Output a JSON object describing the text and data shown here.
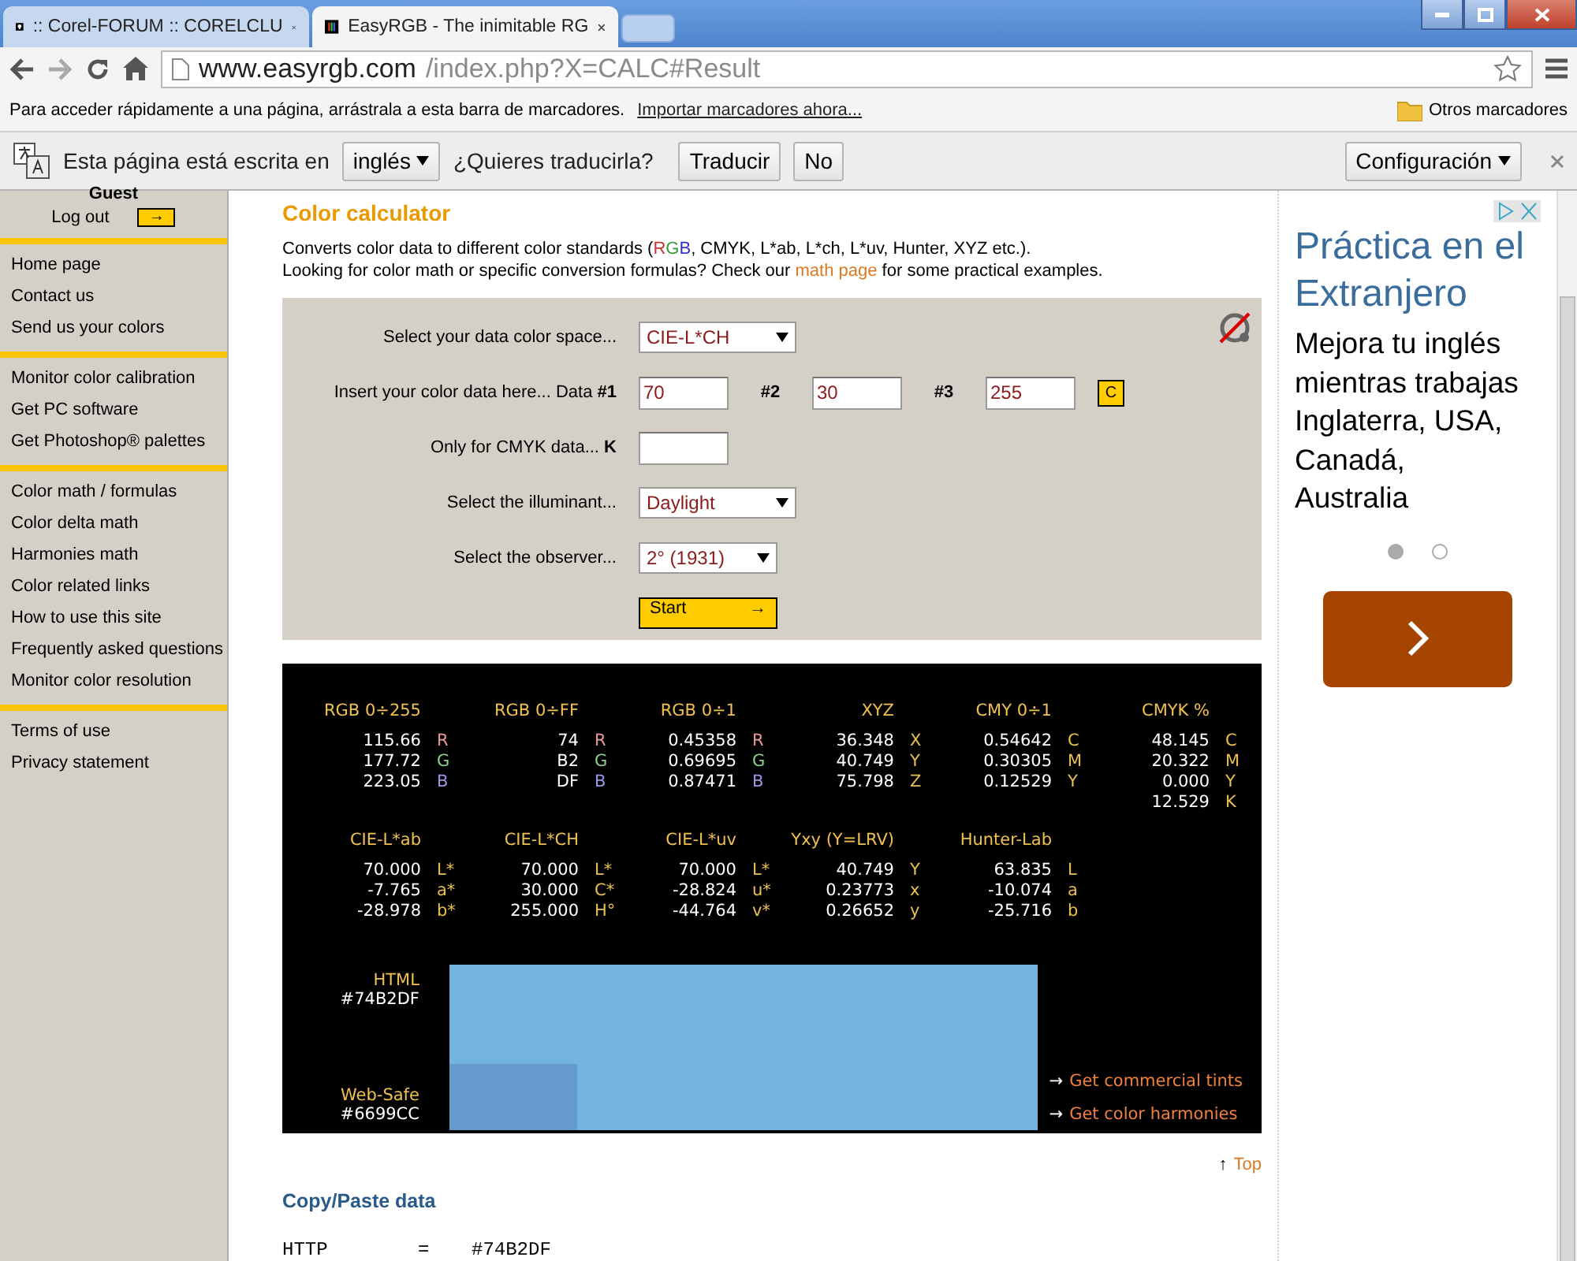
{
  "browser": {
    "tabs": [
      {
        "title": ":: Corel-FORUM :: CORELCLU",
        "selected": false
      },
      {
        "title": "EasyRGB - The inimitable RG",
        "selected": true
      }
    ],
    "url": {
      "host": "www.easyrgb.com",
      "path": "/index.php?X=CALC#Result"
    },
    "bookmarks": {
      "hint": "Para acceder rápidamente a una página, arrástrala a esta barra de marcadores.",
      "import_link": "Importar marcadores ahora...",
      "other": "Otros marcadores"
    },
    "translate": {
      "prefix": "Esta página está escrita en",
      "language": "inglés",
      "question": "¿Quieres traducirla?",
      "translate_button": "Traducir",
      "no_button": "No",
      "settings": "Configuración"
    }
  },
  "sidebar": {
    "user": "Guest",
    "logout": "Log out",
    "logout_arrow": "→",
    "groups": [
      [
        "Home page",
        "Contact us",
        "Send us your colors"
      ],
      [
        "Monitor color calibration",
        "Get PC software",
        "Get Photoshop® palettes"
      ],
      [
        "Color math / formulas",
        "Color delta math",
        "Harmonies math",
        "Color related links",
        "How to use this site",
        "Frequently asked questions",
        "Monitor color resolution"
      ],
      [
        "Terms of use",
        "Privacy statement"
      ]
    ]
  },
  "calculator": {
    "title": "Color calculator",
    "intro_start": "Converts color data to different color standards (",
    "rgb_letters": [
      {
        "text": "R",
        "color": "#cc3333"
      },
      {
        "text": "G",
        "color": "#339933"
      },
      {
        "text": "B",
        "color": "#3333cc"
      }
    ],
    "intro_end": ", CMYK, L*ab, L*ch, L*uv, Hunter, XYZ etc.).",
    "intro2_start": "Looking for color math or specific conversion formulas? Check our ",
    "intro2_link": "math page",
    "intro2_end": " for some practical examples.",
    "rows": [
      {
        "kind": "select",
        "label": "Select your data color space...",
        "value": "CIE-L*CH"
      },
      {
        "kind": "triple",
        "label": "Insert your color data here... Data **#1**",
        "fields": [
          {
            "value": "70"
          },
          {
            "tag": "#2",
            "value": "30"
          },
          {
            "tag": "#3",
            "value": "255"
          }
        ],
        "clear": "C"
      },
      {
        "kind": "input",
        "label": "Only for CMYK data... **K**",
        "value": ""
      },
      {
        "kind": "select",
        "label": "Select the illuminant...",
        "value": "Daylight"
      },
      {
        "kind": "select-small",
        "label": "Select the observer...",
        "value": "2° (1931)"
      },
      {
        "kind": "start",
        "label": "Start",
        "arrow": "→"
      }
    ]
  },
  "results": {
    "groups": [
      [
        {
          "header": "RGB 0÷255",
          "rows": [
            {
              "value": "115.66",
              "unit": "R",
              "color": "#e89a9a"
            },
            {
              "value": "177.72",
              "unit": "G",
              "color": "#8fd08f"
            },
            {
              "value": "223.05",
              "unit": "B",
              "color": "#9a9ae8"
            }
          ]
        },
        {
          "header": "RGB 0÷FF",
          "rows": [
            {
              "value": "74",
              "unit": "R",
              "color": "#e89a9a"
            },
            {
              "value": "B2",
              "unit": "G",
              "color": "#8fd08f"
            },
            {
              "value": "DF",
              "unit": "B",
              "color": "#9a9ae8"
            }
          ]
        },
        {
          "header": "RGB 0÷1",
          "rows": [
            {
              "value": "0.45358",
              "unit": "R",
              "color": "#e89a9a"
            },
            {
              "value": "0.69695",
              "unit": "G",
              "color": "#8fd08f"
            },
            {
              "value": "0.87471",
              "unit": "B",
              "color": "#9a9ae8"
            }
          ]
        },
        {
          "header": "XYZ",
          "rows": [
            {
              "value": "36.348",
              "unit": "X",
              "color": "#e8c050"
            },
            {
              "value": "40.749",
              "unit": "Y",
              "color": "#e8c050"
            },
            {
              "value": "75.798",
              "unit": "Z",
              "color": "#e8c050"
            }
          ]
        },
        {
          "header": "CMY 0÷1",
          "rows": [
            {
              "value": "0.54642",
              "unit": "C",
              "color": "#e8c050"
            },
            {
              "value": "0.30305",
              "unit": "M",
              "color": "#e8c050"
            },
            {
              "value": "0.12529",
              "unit": "Y",
              "color": "#e8c050"
            }
          ]
        },
        {
          "header": "CMYK %",
          "rows": [
            {
              "value": "48.145",
              "unit": "C",
              "color": "#e8c050"
            },
            {
              "value": "20.322",
              "unit": "M",
              "color": "#e8c050"
            },
            {
              "value": "0.000",
              "unit": "Y",
              "color": "#e8c050"
            },
            {
              "value": "12.529",
              "unit": "K",
              "color": "#e8c050"
            }
          ]
        }
      ],
      [
        {
          "header": "CIE-L*ab",
          "rows": [
            {
              "value": "70.000",
              "unit": "L*",
              "color": "#e8c050"
            },
            {
              "value": "-7.765",
              "unit": "a*",
              "color": "#e8c050"
            },
            {
              "value": "-28.978",
              "unit": "b*",
              "color": "#e8c050"
            }
          ]
        },
        {
          "header": "CIE-L*CH",
          "rows": [
            {
              "value": "70.000",
              "unit": "L*",
              "color": "#e8c050"
            },
            {
              "value": "30.000",
              "unit": "C*",
              "color": "#e8c050"
            },
            {
              "value": "255.000",
              "unit": "H°",
              "color": "#e8c050"
            }
          ]
        },
        {
          "header": "CIE-L*uv",
          "rows": [
            {
              "value": "70.000",
              "unit": "L*",
              "color": "#e8c050"
            },
            {
              "value": "-28.824",
              "unit": "u*",
              "color": "#e8c050"
            },
            {
              "value": "-44.764",
              "unit": "v*",
              "color": "#e8c050"
            }
          ]
        },
        {
          "header": "Yxy (Y=LRV)",
          "rows": [
            {
              "value": "40.749",
              "unit": "Y",
              "color": "#e8c050"
            },
            {
              "value": "0.23773",
              "unit": "x",
              "color": "#e8c050"
            },
            {
              "value": "0.26652",
              "unit": "y",
              "color": "#e8c050"
            }
          ]
        },
        {
          "header": "Hunter-Lab",
          "rows": [
            {
              "value": "63.835",
              "unit": "L",
              "color": "#e8c050"
            },
            {
              "value": "-10.074",
              "unit": "a",
              "color": "#e8c050"
            },
            {
              "value": "-25.716",
              "unit": "b",
              "color": "#e8c050"
            }
          ]
        }
      ]
    ],
    "html_label": "HTML",
    "html_value": "#74B2DF",
    "websafe_label": "Web-Safe",
    "websafe_value": "#6699CC",
    "links": [
      {
        "arrow": "→",
        "text": "Get commercial tints"
      },
      {
        "arrow": "→",
        "text": "Get color harmonies"
      }
    ]
  },
  "top_link": {
    "arrow": "↑",
    "text": "Top"
  },
  "copy_paste": {
    "title": "Copy/Paste data",
    "lines": [
      {
        "key": "HTTP",
        "sep": "=",
        "value": "#74B2DF"
      }
    ]
  },
  "ad": {
    "title": "Práctica en el Extranjero",
    "body": "Mejora tu inglés mientras trabajas Inglaterra, USA, Canadá, Australia",
    "dots": [
      {
        "selected": true
      },
      {
        "selected": false
      }
    ]
  }
}
